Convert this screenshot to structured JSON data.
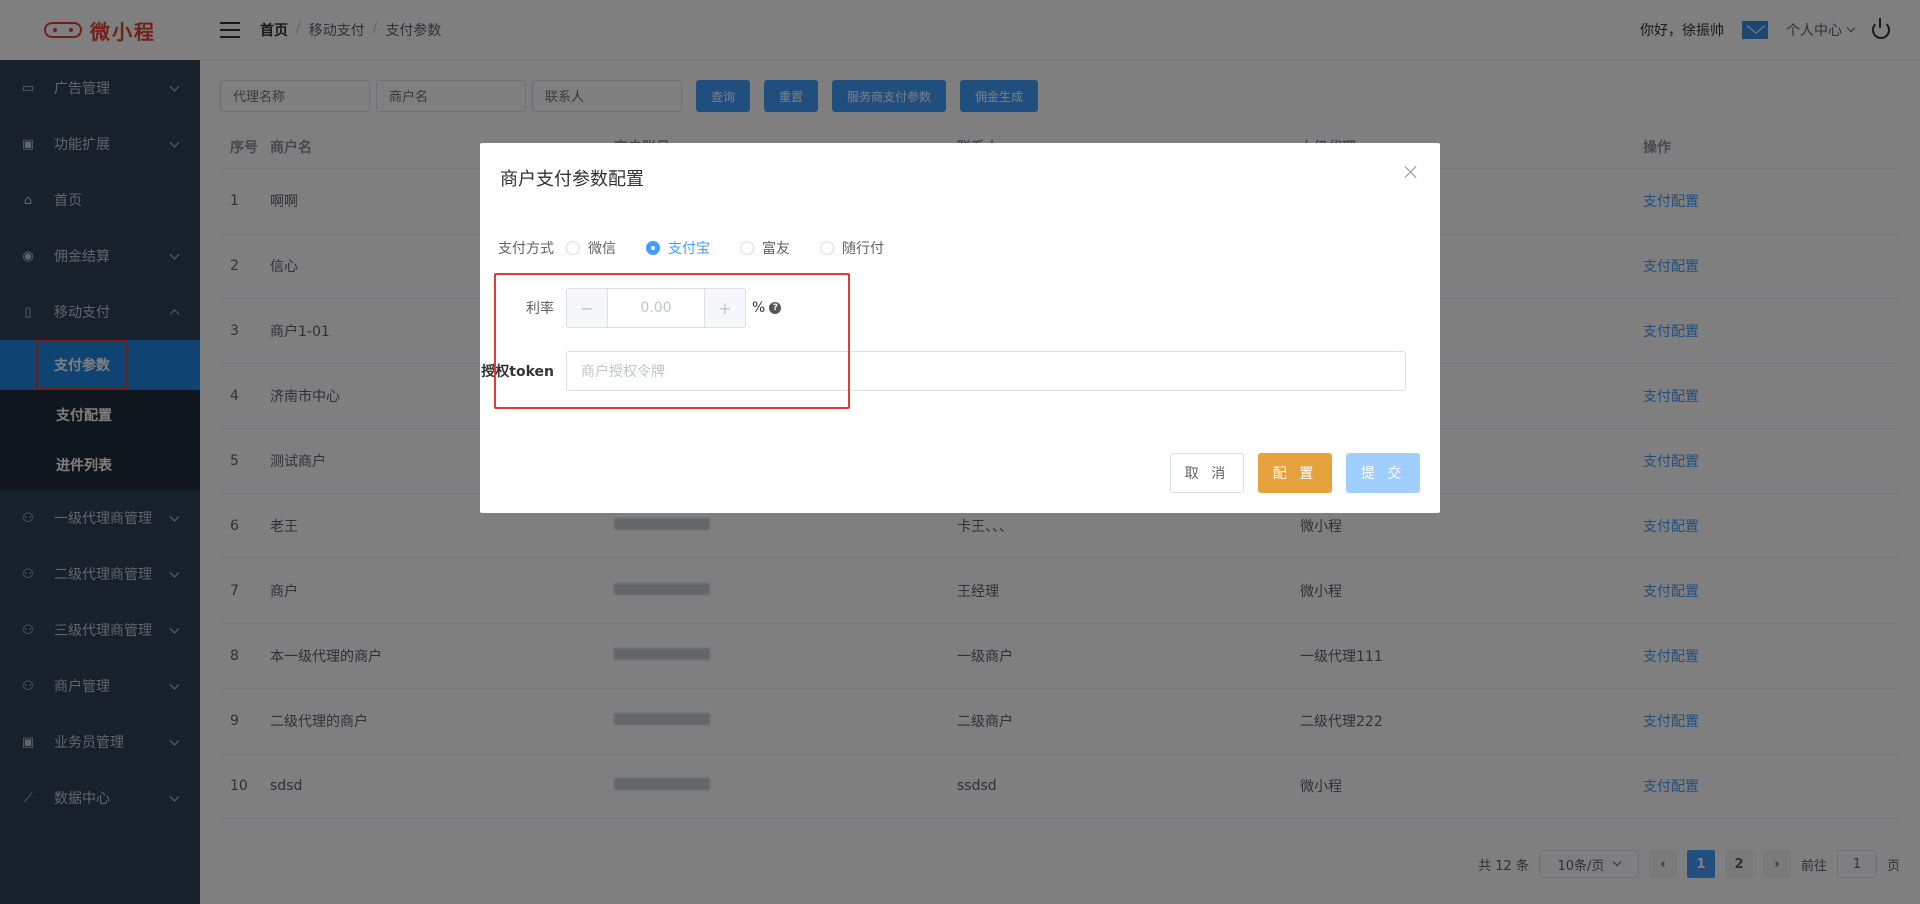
{
  "app": {
    "logo_text": "微小程"
  },
  "sidebar": {
    "items": [
      {
        "label": "广告管理",
        "icon": "ad-icon"
      },
      {
        "label": "功能扩展",
        "icon": "briefcase-icon"
      },
      {
        "label": "首页",
        "icon": "home-icon"
      },
      {
        "label": "佣金结算",
        "icon": "coin-icon"
      },
      {
        "label": "移动支付",
        "icon": "phone-icon",
        "expanded": true
      }
    ],
    "sub_items": [
      "支付参数",
      "支付配置",
      "进件列表"
    ],
    "items_after": [
      {
        "label": "一级代理商管理",
        "icon": "user-icon"
      },
      {
        "label": "二级代理商管理",
        "icon": "user-icon"
      },
      {
        "label": "三级代理商管理",
        "icon": "user-icon"
      },
      {
        "label": "商户管理",
        "icon": "user-icon"
      },
      {
        "label": "业务员管理",
        "icon": "briefcase-icon"
      },
      {
        "label": "数据中心",
        "icon": "chart-icon"
      }
    ]
  },
  "header": {
    "breadcrumb": [
      "首页",
      "移动支付",
      "支付参数"
    ],
    "greeting": "你好，徐振帅",
    "user_center": "个人中心"
  },
  "filters": {
    "agent_placeholder": "代理名称",
    "merchant_placeholder": "商户名",
    "contact_placeholder": "联系人",
    "buttons": [
      "查询",
      "重置",
      "服务商支付参数",
      "佣金生成"
    ]
  },
  "table": {
    "headers": [
      "序号",
      "商户名",
      "商户账号",
      "联系人",
      "上级代理",
      "操作"
    ],
    "rows": [
      {
        "no": "1",
        "name": "啊啊",
        "contact": "",
        "parent": "",
        "action": "支付配置"
      },
      {
        "no": "2",
        "name": "信心",
        "contact": "",
        "parent": "",
        "action": "支付配置"
      },
      {
        "no": "3",
        "name": "商户1-01",
        "contact": "",
        "parent": "",
        "action": "支付配置"
      },
      {
        "no": "4",
        "name": "济南市中心",
        "contact": "",
        "parent": "",
        "action": "支付配置"
      },
      {
        "no": "5",
        "name": "测试商户",
        "contact": "",
        "parent": "",
        "action": "支付配置"
      },
      {
        "no": "6",
        "name": "老王",
        "contact": "卡王、、、",
        "parent": "微小程",
        "action": "支付配置"
      },
      {
        "no": "7",
        "name": "商户",
        "contact": "王经理",
        "parent": "微小程",
        "action": "支付配置"
      },
      {
        "no": "8",
        "name": "本一级代理的商户",
        "contact": "一级商户",
        "parent": "一级代理111",
        "action": "支付配置"
      },
      {
        "no": "9",
        "name": "二级代理的商户",
        "contact": "二级商户",
        "parent": "二级代理222",
        "action": "支付配置"
      },
      {
        "no": "10",
        "name": "sdsd",
        "contact": "ssdsd",
        "parent": "微小程",
        "action": "支付配置"
      }
    ]
  },
  "pagination": {
    "total": "共 12 条",
    "page_size": "10条/页",
    "pages": [
      "1",
      "2"
    ],
    "goto_label": "前往",
    "goto_value": "1",
    "page_unit": "页"
  },
  "dialog": {
    "title": "商户支付参数配置",
    "pay_method_label": "支付方式",
    "pay_methods": [
      "微信",
      "支付宝",
      "富友",
      "随行付"
    ],
    "selected_method": "支付宝",
    "rate_label": "利率",
    "rate_value": "0.00",
    "rate_unit": "%",
    "token_label": "授权token",
    "token_placeholder": "商户授权令牌",
    "cancel": "取 消",
    "config": "配 置",
    "submit": "提 交"
  },
  "colors": {
    "primary": "#409eff",
    "sidebar": "#304156",
    "warning": "#e6a23c",
    "highlight": "#e53935"
  }
}
